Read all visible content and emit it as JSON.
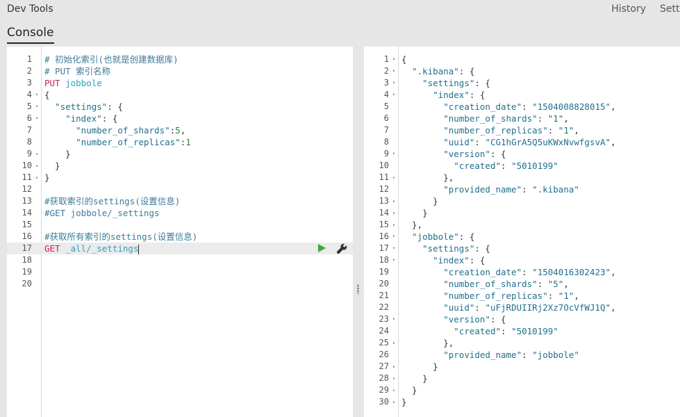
{
  "app": {
    "title": "Dev Tools",
    "nav_history": "History",
    "nav_settings": "Settings",
    "tab_console": "Console"
  },
  "colors": {
    "run_button": "#3caa3c",
    "method": "#c7254e",
    "url": "#2aa0c3",
    "comment": "#3d7a99"
  },
  "icons": {
    "run": "play-icon",
    "wrench": "wrench-icon",
    "fold_open": "fold-open-icon",
    "fold_close": "fold-close-icon"
  },
  "request_editor": {
    "active_line": 17,
    "lines": [
      {
        "n": "1",
        "fold": "",
        "segs": [
          {
            "t": "# 初始化索引(也就是创建数据库)",
            "c": "c-comment"
          }
        ]
      },
      {
        "n": "2",
        "fold": "",
        "segs": [
          {
            "t": "# PUT 索引名称",
            "c": "c-comment"
          }
        ]
      },
      {
        "n": "3",
        "fold": "",
        "segs": [
          {
            "t": "PUT ",
            "c": "c-method"
          },
          {
            "t": "jobbole",
            "c": "c-url"
          }
        ]
      },
      {
        "n": "4",
        "fold": "▾",
        "segs": [
          {
            "t": "{",
            "c": "c-punc"
          }
        ]
      },
      {
        "n": "5",
        "fold": "▾",
        "segs": [
          {
            "t": "  ",
            "c": ""
          },
          {
            "t": "\"settings\"",
            "c": "c-key"
          },
          {
            "t": ": {",
            "c": "c-punc"
          }
        ]
      },
      {
        "n": "6",
        "fold": "▾",
        "segs": [
          {
            "t": "    ",
            "c": ""
          },
          {
            "t": "\"index\"",
            "c": "c-key"
          },
          {
            "t": ": {",
            "c": "c-punc"
          }
        ]
      },
      {
        "n": "7",
        "fold": "",
        "segs": [
          {
            "t": "      ",
            "c": ""
          },
          {
            "t": "\"number_of_shards\"",
            "c": "c-key"
          },
          {
            "t": ":",
            "c": "c-punc"
          },
          {
            "t": "5",
            "c": "c-num"
          },
          {
            "t": ",",
            "c": "c-punc"
          }
        ]
      },
      {
        "n": "8",
        "fold": "",
        "segs": [
          {
            "t": "      ",
            "c": ""
          },
          {
            "t": "\"number_of_replicas\"",
            "c": "c-key"
          },
          {
            "t": ":",
            "c": "c-punc"
          },
          {
            "t": "1",
            "c": "c-num"
          }
        ]
      },
      {
        "n": "9",
        "fold": "▴",
        "segs": [
          {
            "t": "    }",
            "c": "c-punc"
          }
        ]
      },
      {
        "n": "10",
        "fold": "▴",
        "segs": [
          {
            "t": "  }",
            "c": "c-punc"
          }
        ]
      },
      {
        "n": "11",
        "fold": "▴",
        "segs": [
          {
            "t": "}",
            "c": "c-punc"
          }
        ]
      },
      {
        "n": "12",
        "fold": "",
        "segs": []
      },
      {
        "n": "13",
        "fold": "",
        "segs": [
          {
            "t": "#获取索引的settings(设置信息)",
            "c": "c-comment"
          }
        ]
      },
      {
        "n": "14",
        "fold": "",
        "segs": [
          {
            "t": "#GET jobbole/_settings",
            "c": "c-comment"
          }
        ]
      },
      {
        "n": "15",
        "fold": "",
        "segs": []
      },
      {
        "n": "16",
        "fold": "",
        "segs": [
          {
            "t": "#获取所有索引的settings(设置信息)",
            "c": "c-comment"
          }
        ]
      },
      {
        "n": "17",
        "fold": "",
        "segs": [
          {
            "t": "GET ",
            "c": "c-method"
          },
          {
            "t": "_all/_settings",
            "c": "c-url"
          }
        ]
      },
      {
        "n": "18",
        "fold": "",
        "segs": []
      },
      {
        "n": "19",
        "fold": "",
        "segs": []
      },
      {
        "n": "20",
        "fold": "",
        "segs": []
      }
    ]
  },
  "response_viewer": {
    "lines": [
      {
        "n": "1",
        "fold": "▾",
        "segs": [
          {
            "t": "{",
            "c": "c-punc"
          }
        ]
      },
      {
        "n": "2",
        "fold": "▾",
        "segs": [
          {
            "t": "  ",
            "c": ""
          },
          {
            "t": "\".kibana\"",
            "c": "c-key"
          },
          {
            "t": ": {",
            "c": "c-punc"
          }
        ]
      },
      {
        "n": "3",
        "fold": "▾",
        "segs": [
          {
            "t": "    ",
            "c": ""
          },
          {
            "t": "\"settings\"",
            "c": "c-key"
          },
          {
            "t": ": {",
            "c": "c-punc"
          }
        ]
      },
      {
        "n": "4",
        "fold": "▾",
        "segs": [
          {
            "t": "      ",
            "c": ""
          },
          {
            "t": "\"index\"",
            "c": "c-key"
          },
          {
            "t": ": {",
            "c": "c-punc"
          }
        ]
      },
      {
        "n": "5",
        "fold": "",
        "segs": [
          {
            "t": "        ",
            "c": ""
          },
          {
            "t": "\"creation_date\"",
            "c": "c-key"
          },
          {
            "t": ": ",
            "c": "c-punc"
          },
          {
            "t": "\"1504008828015\"",
            "c": "c-str"
          },
          {
            "t": ",",
            "c": "c-punc"
          }
        ]
      },
      {
        "n": "6",
        "fold": "",
        "segs": [
          {
            "t": "        ",
            "c": ""
          },
          {
            "t": "\"number_of_shards\"",
            "c": "c-key"
          },
          {
            "t": ": ",
            "c": "c-punc"
          },
          {
            "t": "\"1\"",
            "c": "c-str"
          },
          {
            "t": ",",
            "c": "c-punc"
          }
        ]
      },
      {
        "n": "7",
        "fold": "",
        "segs": [
          {
            "t": "        ",
            "c": ""
          },
          {
            "t": "\"number_of_replicas\"",
            "c": "c-key"
          },
          {
            "t": ": ",
            "c": "c-punc"
          },
          {
            "t": "\"1\"",
            "c": "c-str"
          },
          {
            "t": ",",
            "c": "c-punc"
          }
        ]
      },
      {
        "n": "8",
        "fold": "",
        "segs": [
          {
            "t": "        ",
            "c": ""
          },
          {
            "t": "\"uuid\"",
            "c": "c-key"
          },
          {
            "t": ": ",
            "c": "c-punc"
          },
          {
            "t": "\"CG1hGrA5Q5uKWxNvwfgsvA\"",
            "c": "c-str"
          },
          {
            "t": ",",
            "c": "c-punc"
          }
        ]
      },
      {
        "n": "9",
        "fold": "▾",
        "segs": [
          {
            "t": "        ",
            "c": ""
          },
          {
            "t": "\"version\"",
            "c": "c-key"
          },
          {
            "t": ": {",
            "c": "c-punc"
          }
        ]
      },
      {
        "n": "10",
        "fold": "",
        "segs": [
          {
            "t": "          ",
            "c": ""
          },
          {
            "t": "\"created\"",
            "c": "c-key"
          },
          {
            "t": ": ",
            "c": "c-punc"
          },
          {
            "t": "\"5010199\"",
            "c": "c-str"
          }
        ]
      },
      {
        "n": "11",
        "fold": "▴",
        "segs": [
          {
            "t": "        },",
            "c": "c-punc"
          }
        ]
      },
      {
        "n": "12",
        "fold": "",
        "segs": [
          {
            "t": "        ",
            "c": ""
          },
          {
            "t": "\"provided_name\"",
            "c": "c-key"
          },
          {
            "t": ": ",
            "c": "c-punc"
          },
          {
            "t": "\".kibana\"",
            "c": "c-str"
          }
        ]
      },
      {
        "n": "13",
        "fold": "▴",
        "segs": [
          {
            "t": "      }",
            "c": "c-punc"
          }
        ]
      },
      {
        "n": "14",
        "fold": "▴",
        "segs": [
          {
            "t": "    }",
            "c": "c-punc"
          }
        ]
      },
      {
        "n": "15",
        "fold": "▴",
        "segs": [
          {
            "t": "  },",
            "c": "c-punc"
          }
        ]
      },
      {
        "n": "16",
        "fold": "▾",
        "segs": [
          {
            "t": "  ",
            "c": ""
          },
          {
            "t": "\"jobbole\"",
            "c": "c-key"
          },
          {
            "t": ": {",
            "c": "c-punc"
          }
        ]
      },
      {
        "n": "17",
        "fold": "▾",
        "segs": [
          {
            "t": "    ",
            "c": ""
          },
          {
            "t": "\"settings\"",
            "c": "c-key"
          },
          {
            "t": ": {",
            "c": "c-punc"
          }
        ]
      },
      {
        "n": "18",
        "fold": "▾",
        "segs": [
          {
            "t": "      ",
            "c": ""
          },
          {
            "t": "\"index\"",
            "c": "c-key"
          },
          {
            "t": ": {",
            "c": "c-punc"
          }
        ]
      },
      {
        "n": "19",
        "fold": "",
        "segs": [
          {
            "t": "        ",
            "c": ""
          },
          {
            "t": "\"creation_date\"",
            "c": "c-key"
          },
          {
            "t": ": ",
            "c": "c-punc"
          },
          {
            "t": "\"1504016302423\"",
            "c": "c-str"
          },
          {
            "t": ",",
            "c": "c-punc"
          }
        ]
      },
      {
        "n": "20",
        "fold": "",
        "segs": [
          {
            "t": "        ",
            "c": ""
          },
          {
            "t": "\"number_of_shards\"",
            "c": "c-key"
          },
          {
            "t": ": ",
            "c": "c-punc"
          },
          {
            "t": "\"5\"",
            "c": "c-str"
          },
          {
            "t": ",",
            "c": "c-punc"
          }
        ]
      },
      {
        "n": "21",
        "fold": "",
        "segs": [
          {
            "t": "        ",
            "c": ""
          },
          {
            "t": "\"number_of_replicas\"",
            "c": "c-key"
          },
          {
            "t": ": ",
            "c": "c-punc"
          },
          {
            "t": "\"1\"",
            "c": "c-str"
          },
          {
            "t": ",",
            "c": "c-punc"
          }
        ]
      },
      {
        "n": "22",
        "fold": "",
        "segs": [
          {
            "t": "        ",
            "c": ""
          },
          {
            "t": "\"uuid\"",
            "c": "c-key"
          },
          {
            "t": ": ",
            "c": "c-punc"
          },
          {
            "t": "\"uFjRDUIIRj2Xz7OcVfWJ1Q\"",
            "c": "c-str"
          },
          {
            "t": ",",
            "c": "c-punc"
          }
        ]
      },
      {
        "n": "23",
        "fold": "▾",
        "segs": [
          {
            "t": "        ",
            "c": ""
          },
          {
            "t": "\"version\"",
            "c": "c-key"
          },
          {
            "t": ": {",
            "c": "c-punc"
          }
        ]
      },
      {
        "n": "24",
        "fold": "",
        "segs": [
          {
            "t": "          ",
            "c": ""
          },
          {
            "t": "\"created\"",
            "c": "c-key"
          },
          {
            "t": ": ",
            "c": "c-punc"
          },
          {
            "t": "\"5010199\"",
            "c": "c-str"
          }
        ]
      },
      {
        "n": "25",
        "fold": "▴",
        "segs": [
          {
            "t": "        },",
            "c": "c-punc"
          }
        ]
      },
      {
        "n": "26",
        "fold": "",
        "segs": [
          {
            "t": "        ",
            "c": ""
          },
          {
            "t": "\"provided_name\"",
            "c": "c-key"
          },
          {
            "t": ": ",
            "c": "c-punc"
          },
          {
            "t": "\"jobbole\"",
            "c": "c-str"
          }
        ]
      },
      {
        "n": "27",
        "fold": "▴",
        "segs": [
          {
            "t": "      }",
            "c": "c-punc"
          }
        ]
      },
      {
        "n": "28",
        "fold": "▴",
        "segs": [
          {
            "t": "    }",
            "c": "c-punc"
          }
        ]
      },
      {
        "n": "29",
        "fold": "▴",
        "segs": [
          {
            "t": "  }",
            "c": "c-punc"
          }
        ]
      },
      {
        "n": "30",
        "fold": "▴",
        "segs": [
          {
            "t": "}",
            "c": "c-punc"
          }
        ]
      }
    ]
  }
}
